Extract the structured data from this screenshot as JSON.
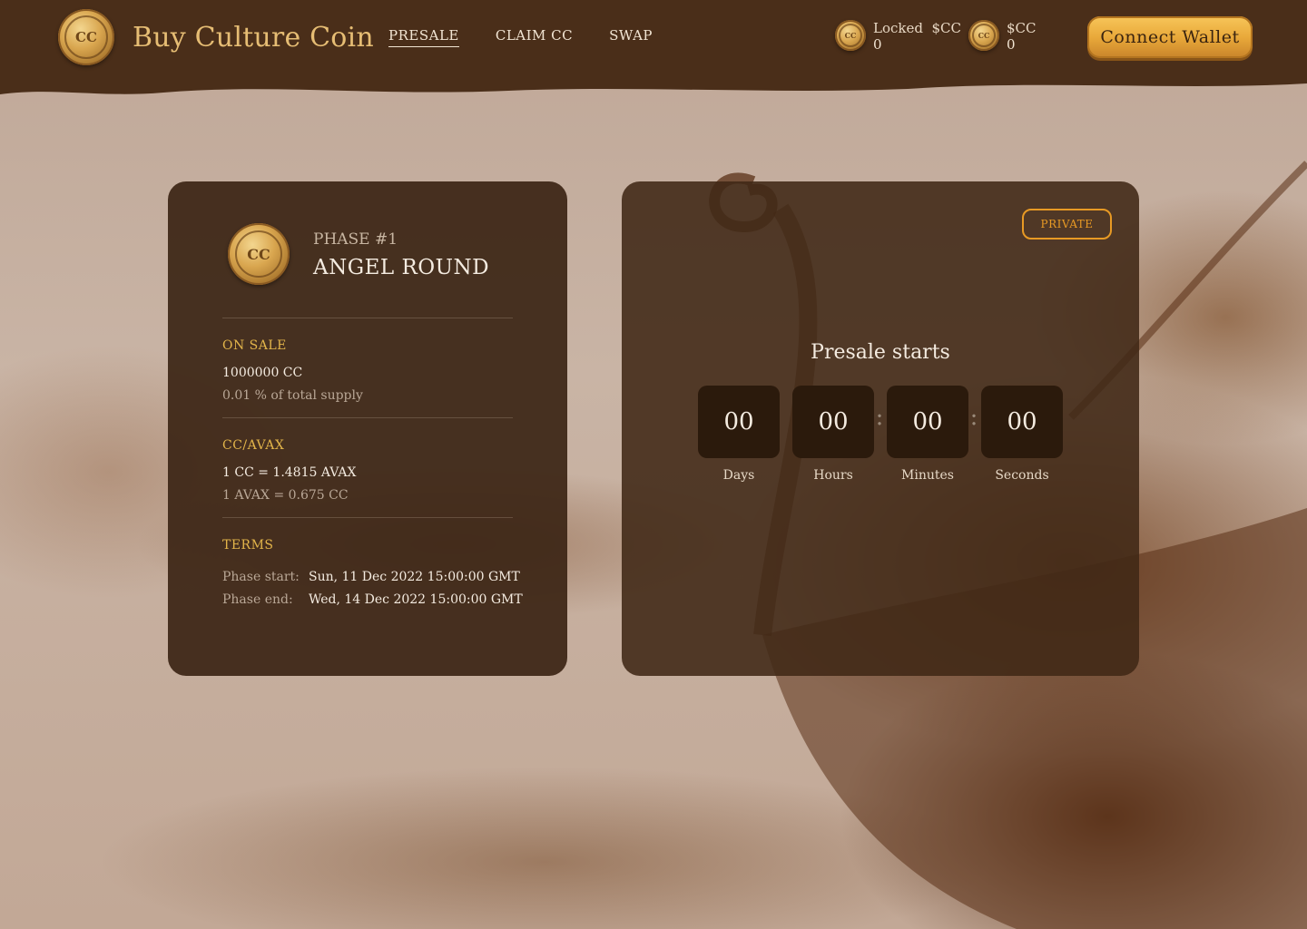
{
  "brand": {
    "title": "Buy Culture Coin",
    "coin_mark": "CC"
  },
  "nav": {
    "items": [
      "PRESALE",
      "CLAIM CC",
      "SWAP"
    ],
    "active": "PRESALE"
  },
  "balances": [
    {
      "label": "Locked  $CC",
      "value": "0"
    },
    {
      "label": "$CC",
      "value": "0"
    }
  ],
  "connect_label": "Connect Wallet",
  "phase": {
    "label": "PHASE #1",
    "name": "ANGEL ROUND",
    "on_sale": {
      "title": "ON SALE",
      "amount": "1000000 CC",
      "share": "0.01 % of total supply"
    },
    "rate": {
      "title": "CC/AVAX",
      "primary": "1 CC = 1.4815 AVAX",
      "secondary": "1 AVAX = 0.675 CC"
    },
    "terms": {
      "title": "TERMS",
      "start_label": "Phase start:",
      "start_value": "Sun, 11 Dec 2022 15:00:00 GMT",
      "end_label": "Phase end:",
      "end_value": "Wed, 14 Dec 2022 15:00:00 GMT"
    }
  },
  "presale": {
    "badge": "PRIVATE",
    "title": "Presale starts",
    "timer": [
      {
        "value": "00",
        "label": "Days"
      },
      {
        "value": "00",
        "label": "Hours"
      },
      {
        "value": "00",
        "label": "Minutes"
      },
      {
        "value": "00",
        "label": "Seconds"
      }
    ]
  },
  "colors": {
    "header": "#4a2e19",
    "accent_gold": "#e3b54a",
    "badge_orange": "#e89a24",
    "card": "#3c2616"
  }
}
